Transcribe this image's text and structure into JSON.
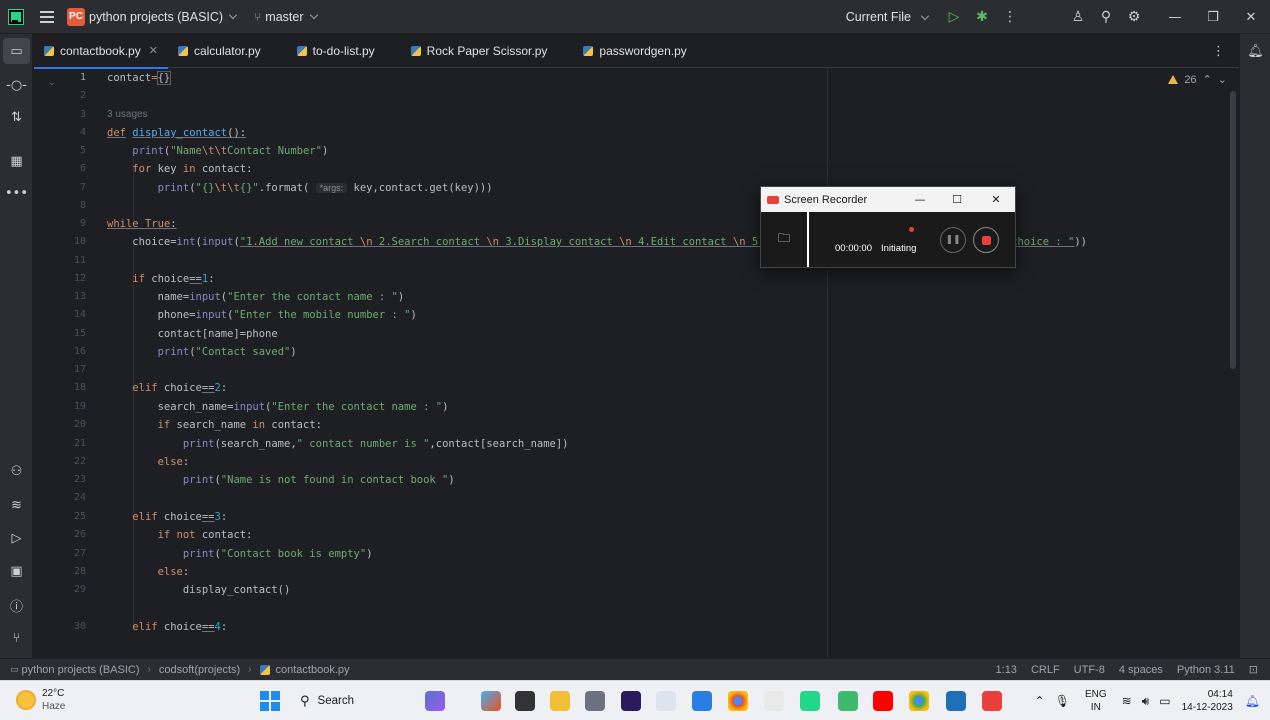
{
  "titlebar": {
    "project_badge": "PC",
    "project_name": "python projects (BASIC)",
    "branch": "master",
    "run_config": "Current File"
  },
  "tabs": [
    {
      "label": "contactbook.py",
      "active": true
    },
    {
      "label": "calculator.py"
    },
    {
      "label": "to-do-list.py"
    },
    {
      "label": "Rock Paper Scissor.py"
    },
    {
      "label": "passwordgen.py"
    }
  ],
  "editor": {
    "warnings_count": "26",
    "usages_hint": "3 usages",
    "param_hint": "*args:",
    "line_numbers": [
      "1",
      "2",
      "3",
      "4",
      "5",
      "6",
      "7",
      "8",
      "9",
      "10",
      "11",
      "12",
      "13",
      "14",
      "15",
      "16",
      "17",
      "18",
      "19",
      "20",
      "21",
      "22",
      "23",
      "24",
      "25",
      "26",
      "27",
      "28",
      "29",
      "30"
    ]
  },
  "recorder": {
    "title": "Screen Recorder",
    "time": "00:00:00",
    "status": "Initiating"
  },
  "statusbar": {
    "breadcrumb": [
      "python projects (BASIC)",
      "codsoft(projects)",
      "contactbook.py"
    ],
    "position": "1:13",
    "line_sep": "CRLF",
    "encoding": "UTF-8",
    "indent": "4 spaces",
    "interpreter": "Python 3.11"
  },
  "taskbar": {
    "temperature": "22°C",
    "weather": "Haze",
    "search": "Search",
    "lang_top": "ENG",
    "lang_bottom": "IN",
    "time": "04:14",
    "date": "14-12-2023"
  },
  "icons": {
    "menu": "hamburger-icon",
    "branch": "git-branch-icon",
    "run": "run-icon",
    "debug": "debug-icon",
    "notifications": "bell-icon"
  }
}
